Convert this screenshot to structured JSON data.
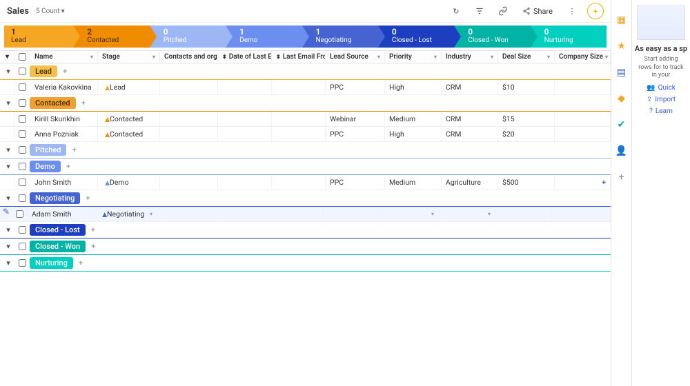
{
  "topbar": {
    "title": "Sales",
    "count_label": "5 Count",
    "share_label": "Share"
  },
  "funnel": [
    {
      "count": "1",
      "label": "Lead",
      "cls": "c0"
    },
    {
      "count": "2",
      "label": "Contacted",
      "cls": "c1"
    },
    {
      "count": "0",
      "label": "Pitched",
      "cls": "c2"
    },
    {
      "count": "1",
      "label": "Demo",
      "cls": "c3"
    },
    {
      "count": "1",
      "label": "Negotiating",
      "cls": "c4"
    },
    {
      "count": "0",
      "label": "Closed - Lost",
      "cls": "c5"
    },
    {
      "count": "0",
      "label": "Closed - Won",
      "cls": "c6"
    },
    {
      "count": "0",
      "label": "Nurturing",
      "cls": "c7"
    }
  ],
  "columns": {
    "name": "Name",
    "stage": "Stage",
    "contacts": "Contacts and organizations",
    "date": "Date of Last Email",
    "from": "Last Email From",
    "source": "Lead Source",
    "priority": "Priority",
    "industry": "Industry",
    "deal": "Deal Size",
    "company": "Company Size"
  },
  "groups": [
    {
      "tag": "Lead",
      "tagbg": "#f5c04a",
      "border": "border-b-orange",
      "rows": [
        {
          "name": "Valeria Kakovkina",
          "stage": "Lead",
          "dot": "dot-orange",
          "source": "PPC",
          "priority": "High",
          "industry": "CRM",
          "deal": "$10"
        }
      ]
    },
    {
      "tag": "Contacted",
      "tagbg": "#f0a030",
      "border": "border-b-amber",
      "rows": [
        {
          "name": "Kirill Skurikhin",
          "stage": "Contacted",
          "dot": "dot-amber",
          "source": "Webinar",
          "priority": "Medium",
          "industry": "CRM",
          "deal": "$15"
        },
        {
          "name": "Anna Pozniak",
          "stage": "Contacted",
          "dot": "dot-amber",
          "source": "PPC",
          "priority": "High",
          "industry": "CRM",
          "deal": "$20"
        }
      ]
    },
    {
      "tag": "Pitched",
      "tagbg": "#9db7f5",
      "tagfg": "#fff",
      "border": "border-b-lblue",
      "rows": []
    },
    {
      "tag": "Demo",
      "tagbg": "#6b8ef0",
      "tagfg": "#fff",
      "border": "border-b-blue",
      "rows": [
        {
          "name": "John Smith",
          "stage": "Demo",
          "dot": "dot-blue",
          "source": "PPC",
          "priority": "Medium",
          "industry": "Agriculture",
          "deal": "$500",
          "trailing_plus": true
        }
      ]
    },
    {
      "tag": "Negotiating",
      "tagbg": "#4563d1",
      "tagfg": "#fff",
      "border": "border-b-dblue",
      "rows": [
        {
          "name": "Adam Smith",
          "stage": "Negotiating",
          "dot": "dot-dblue",
          "editable": true
        }
      ]
    },
    {
      "tag": "Closed - Lost",
      "tagbg": "#1d3fbf",
      "tagfg": "#fff",
      "border": "border-b-navy",
      "rows": []
    },
    {
      "tag": "Closed - Won",
      "tagbg": "#00b3a4",
      "tagfg": "#fff",
      "border": "border-b-teal",
      "rows": []
    },
    {
      "tag": "Nurturing",
      "tagbg": "#00d0bd",
      "tagfg": "#fff",
      "border": "border-b-mint",
      "rows": []
    }
  ],
  "sidepanel": {
    "heading": "As easy as a sp",
    "sub": "Start adding rows for to track in your",
    "actions": [
      "Quick",
      "Import",
      "Learn"
    ]
  },
  "icons": {
    "refresh": "↻",
    "filter": "⚲",
    "link": "🔗",
    "more": "⋮",
    "plus": "+",
    "caret": "▾",
    "leftcaret": "◂",
    "check": "☑",
    "edit": "✎"
  }
}
